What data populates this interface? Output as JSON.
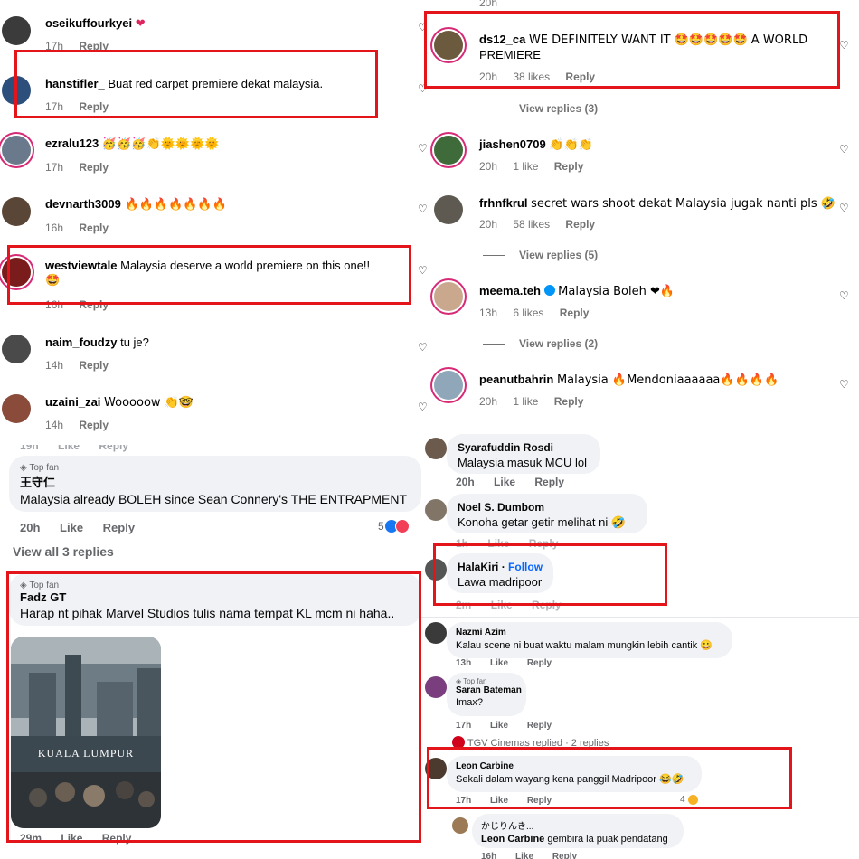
{
  "ig_left": {
    "comments": [
      {
        "user": "oseikuffourkyei",
        "text": "❤",
        "time": "17h",
        "reply": "Reply",
        "likes": ""
      },
      {
        "user": "hanstifler_",
        "text": "Buat red carpet premiere dekat malaysia.",
        "time": "17h",
        "reply": "Reply",
        "likes": ""
      },
      {
        "user": "ezralu123",
        "text": "🥳🥳🥳👏🌞🌞🌞🌞",
        "time": "17h",
        "reply": "Reply",
        "likes": ""
      },
      {
        "user": "devnarth3009",
        "text": "🔥🔥🔥🔥🔥🔥🔥",
        "time": "16h",
        "reply": "Reply",
        "likes": ""
      },
      {
        "user": "westviewtale",
        "text": "Malaysia deserve a world premiere on this one!!",
        "text2": "🤩",
        "time": "16h",
        "reply": "Reply",
        "likes": ""
      },
      {
        "user": "naim_foudzy",
        "text": "tu je?",
        "time": "14h",
        "reply": "Reply",
        "likes": ""
      },
      {
        "user": "uzaini_zai",
        "text": "Wooooow 👏🤓",
        "time": "14h",
        "reply": "Reply",
        "likes": ""
      }
    ]
  },
  "ig_right": {
    "top_time": "20h",
    "comments": [
      {
        "user": "ds12_ca",
        "text": "WE DEFINITELY WANT IT 🤩🤩🤩🤩🤩 A WORLD",
        "text2": "PREMIERE",
        "time": "20h",
        "likes": "38 likes",
        "reply": "Reply"
      },
      {
        "user": "jiashen0709",
        "text": "👏👏👏",
        "time": "20h",
        "likes": "1 like",
        "reply": "Reply"
      },
      {
        "user": "frhnfkrul",
        "text": "secret wars shoot dekat Malaysia jugak nanti pls 🤣",
        "time": "20h",
        "likes": "58 likes",
        "reply": "Reply"
      },
      {
        "user": "meema.teh",
        "text": "Malaysia Boleh ❤🔥",
        "time": "13h",
        "likes": "6 likes",
        "reply": "Reply"
      },
      {
        "user": "peanutbahrin",
        "text": "Malaysia 🔥Mendoniaaaaaa🔥🔥🔥🔥",
        "time": "20h",
        "likes": "1 like",
        "reply": "Reply"
      }
    ],
    "view_replies": [
      "View replies (3)",
      "View replies (5)",
      "View replies (2)"
    ]
  },
  "fb_left": {
    "top_cut": [
      "19h",
      "Like",
      "Reply"
    ],
    "comments": [
      {
        "badge": "Top fan",
        "name": "王守仁",
        "text": "Malaysia already BOLEH since Sean Connery's THE ENTRAPMENT",
        "time": "20h",
        "like": "Like",
        "reply": "Reply",
        "reactions": "5"
      },
      {
        "badge": "Top fan",
        "name": "Fadz GT",
        "text": "Harap nt pihak Marvel Studios tulis nama tempat KL mcm ni haha..",
        "time": "29m",
        "like": "Like",
        "reply": "Reply"
      }
    ],
    "view_all": "View all 3 replies",
    "photo_caption": "KUALA LUMPUR"
  },
  "fb_right": {
    "comments": [
      {
        "name": "Syarafuddin Rosdi",
        "text": "Malaysia masuk MCU lol",
        "time": "20h",
        "like": "Like",
        "reply": "Reply"
      },
      {
        "name": "Noel S. Dumbom",
        "text": "Konoha getar getir melihat ni 🤣",
        "time": "1h",
        "like": "Like",
        "reply": "Reply"
      },
      {
        "name": "HalaKiri",
        "follow": "Follow",
        "text": "Lawa madripoor",
        "time": "2m",
        "like": "Like",
        "reply": "Reply"
      },
      {
        "name": "Nazmi Azim",
        "text": "Kalau scene ni buat waktu malam mungkin lebih cantik 😀",
        "time": "13h",
        "like": "Like",
        "reply": "Reply"
      },
      {
        "badge": "Top fan",
        "name": "Saran Bateman",
        "text": "Imax?",
        "time": "17h",
        "like": "Like",
        "reply": "Reply"
      },
      {
        "name": "Leon Carbine",
        "text": "Sekali dalam wayang kena panggil Madripoor 😂🤣",
        "time": "17h",
        "like": "Like",
        "reply": "Reply",
        "reactions": "4"
      },
      {
        "name": "かじりんき...",
        "text_bold": "Leon Carbine",
        "text": "gembira la puak pendatang",
        "time": "16h",
        "like": "Like",
        "reply": "Reply"
      }
    ],
    "tgv_replied": "TGV Cinemas replied · 2 replies"
  },
  "colors": {
    "highlight": "#e3151b",
    "fb_bubble": "#f0f2f5",
    "fb_link": "#0866ff",
    "ig_meta": "#737373"
  }
}
